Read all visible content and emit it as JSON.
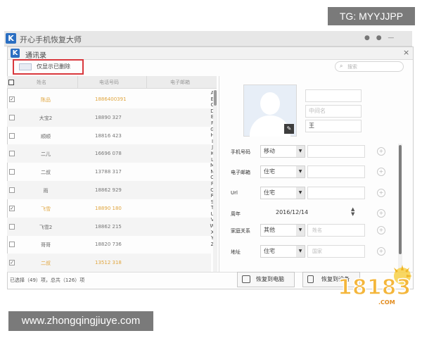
{
  "overlay": {
    "tg_badge": "TG: MYYJJPP",
    "url_badge": "www.zhongqingjiuye.com",
    "site_logo": "18183.COM"
  },
  "app": {
    "title": "开心手机恢复大师",
    "logo_letter": "K"
  },
  "dialog": {
    "title": "通讯录",
    "logo_letter": "K",
    "close": "×"
  },
  "toolbar": {
    "filter_label": "仅显示已删除",
    "search_placeholder": "搜索",
    "search_icon": "search-icon"
  },
  "table": {
    "headers": [
      "姓名",
      "电话号码",
      "电子邮箱"
    ],
    "rows": [
      {
        "name": "陈品",
        "phone": "1886400391",
        "checked": true,
        "deleted": true
      },
      {
        "name": "大宝2",
        "phone": "18890 327",
        "checked": false,
        "deleted": false
      },
      {
        "name": "顺顺",
        "phone": "18816 423",
        "checked": false,
        "deleted": false
      },
      {
        "name": "二儿",
        "phone": "16696 078",
        "checked": false,
        "deleted": false
      },
      {
        "name": "二叔",
        "phone": "13788 317",
        "checked": false,
        "deleted": false
      },
      {
        "name": "雨",
        "phone": "18862 929",
        "checked": false,
        "deleted": false
      },
      {
        "name": "飞雪",
        "phone": "18890 180",
        "checked": true,
        "deleted": true
      },
      {
        "name": "飞雪2",
        "phone": "18862 215",
        "checked": false,
        "deleted": false
      },
      {
        "name": "哥哥",
        "phone": "18820 736",
        "checked": false,
        "deleted": false
      },
      {
        "name": "二叔",
        "phone": "13512 318",
        "checked": true,
        "deleted": true
      }
    ]
  },
  "alphabet": [
    "A",
    "B",
    "C",
    "D",
    "E",
    "F",
    "G",
    "H",
    "I",
    "J",
    "K",
    "L",
    "M",
    "N",
    "O",
    "P",
    "Q",
    "R",
    "S",
    "T",
    "U",
    "V",
    "W",
    "X",
    "Y",
    "Z"
  ],
  "status": "已选择（49）项，总共（126）项",
  "contact": {
    "name_fields": [
      {
        "value": "",
        "placeholder": "",
        "filled": false
      },
      {
        "value": "",
        "placeholder": "中间名",
        "filled": false
      },
      {
        "value": "王",
        "placeholder": "",
        "filled": true
      }
    ],
    "fields": [
      {
        "label": "手机号码",
        "type": "移动",
        "value": ""
      },
      {
        "label": "电子邮箱",
        "type": "住宅",
        "value": ""
      },
      {
        "label": "Url",
        "type": "住宅",
        "value": ""
      },
      {
        "label": "周年",
        "type": "",
        "value": "2016/12/14"
      },
      {
        "label": "家庭关系",
        "type": "其他",
        "value": "姓名"
      },
      {
        "label": "地址",
        "type": "住宅",
        "value": "国家"
      }
    ]
  },
  "buttons": {
    "restore_device": "恢复到电脑",
    "restore_phone": "恢复到设备"
  }
}
